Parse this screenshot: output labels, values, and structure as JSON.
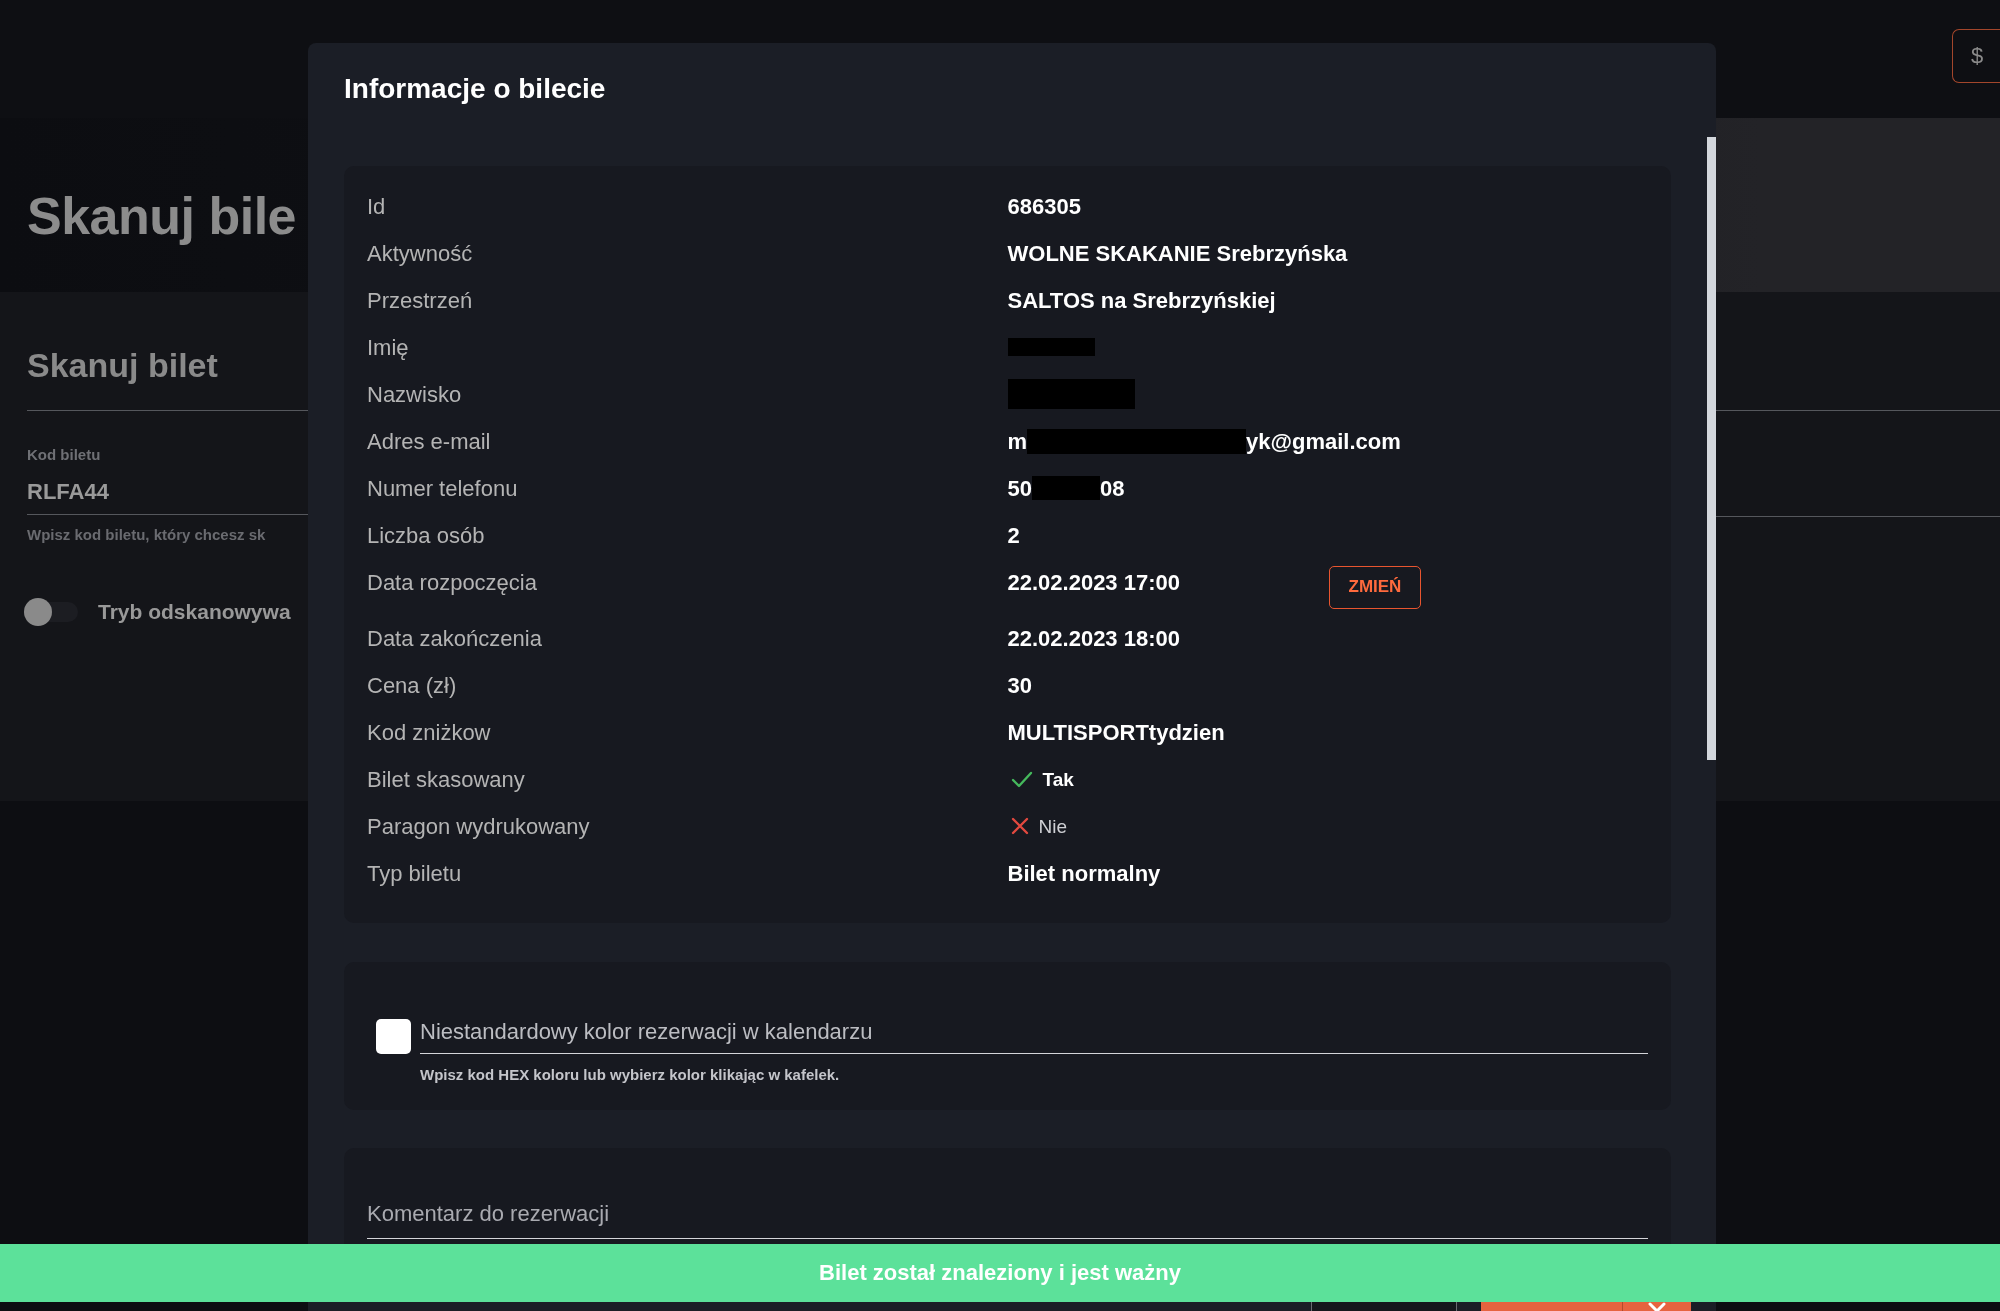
{
  "top_bar": {
    "currency_button": "$"
  },
  "hero": {
    "title": "Skanuj bile"
  },
  "scan_card": {
    "title": "Skanuj bilet",
    "code_field": {
      "label": "Kod biletu",
      "value": "RLFA44"
    },
    "hint": "Wpisz kod biletu, który chcesz sk",
    "rescan_toggle": {
      "label": "Tryb odskanowywa",
      "on": false
    }
  },
  "modal": {
    "title": "Informacje o bilecie",
    "details": [
      {
        "kind": "text",
        "label": "Id",
        "value": "686305"
      },
      {
        "kind": "text",
        "label": "Aktywność",
        "value": "WOLNE SKAKANIE Srebrzyńska"
      },
      {
        "kind": "text",
        "label": "Przestrzeń",
        "value": "SALTOS na Srebrzyńskiej"
      },
      {
        "kind": "redacted",
        "label": "Imię"
      },
      {
        "kind": "redacted",
        "label": "Nazwisko"
      },
      {
        "kind": "redacted",
        "label": "Adres e-mail",
        "prefix": "m",
        "suffix": "yk@gmail.com"
      },
      {
        "kind": "redacted",
        "label": "Numer telefonu",
        "prefix": "50",
        "suffix": "08"
      },
      {
        "kind": "text",
        "label": "Liczba osób",
        "value": "2"
      },
      {
        "kind": "date_edit",
        "label": "Data rozpoczęcia",
        "value": "22.02.2023 17:00",
        "button": "ZMIEŃ"
      },
      {
        "kind": "text",
        "label": "Data zakończenia",
        "value": "22.02.2023 18:00"
      },
      {
        "kind": "text",
        "label": "Cena (zł)",
        "value": "30"
      },
      {
        "kind": "text",
        "label": "Kod zniżkow",
        "value": "MULTISPORTtydzien"
      },
      {
        "kind": "boolean",
        "label": "Bilet skasowany",
        "checked": true,
        "value": "Tak"
      },
      {
        "kind": "boolean",
        "label": "Paragon wydrukowany",
        "checked": false,
        "value": "Nie"
      },
      {
        "kind": "text",
        "label": "Typ biletu",
        "value": "Bilet normalny"
      }
    ],
    "color_field": {
      "color": "#ffffff",
      "placeholder": "Niestandardowy kolor rezerwacji w kalendarzu",
      "hint": "Wpisz kod HEX koloru lub wybierz kolor klikając w kafelek."
    },
    "comment_field": {
      "placeholder": "Komentarz do rezerwacji"
    },
    "buttons": [
      {
        "kind": "secondary"
      },
      {
        "kind": "primary"
      }
    ]
  },
  "toast": {
    "message": "Bilet został znaleziony i jest ważny"
  }
}
